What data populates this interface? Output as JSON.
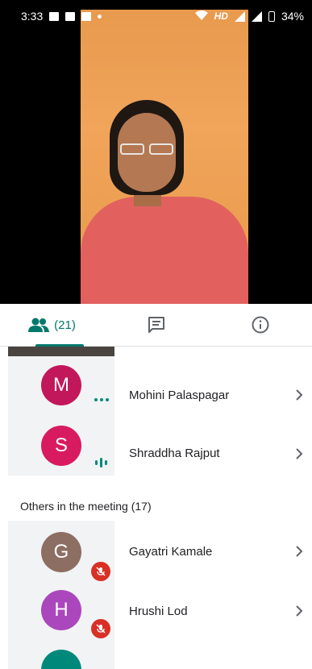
{
  "status_bar": {
    "time": "3:33",
    "network_label": "HD",
    "battery": "34%"
  },
  "tabs": {
    "people_count": "(21)"
  },
  "participants": [
    {
      "initial": "M",
      "name": "Mohini Palaspagar",
      "color": "#c2185b",
      "indicator": "dots"
    },
    {
      "initial": "S",
      "name": "Shraddha Rajput",
      "color": "#d81b60",
      "indicator": "talking"
    }
  ],
  "others_section": {
    "heading": "Others in the meeting (17)",
    "participants": [
      {
        "initial": "G",
        "name": "Gayatri Kamale",
        "color": "#8d6e63",
        "muted": true
      },
      {
        "initial": "H",
        "name": "Hrushi Lod",
        "color": "#ab47bc",
        "muted": true
      }
    ],
    "partial_avatar_color": "#00897b"
  },
  "colors": {
    "accent": "#00796b",
    "muted_red": "#d93025"
  }
}
